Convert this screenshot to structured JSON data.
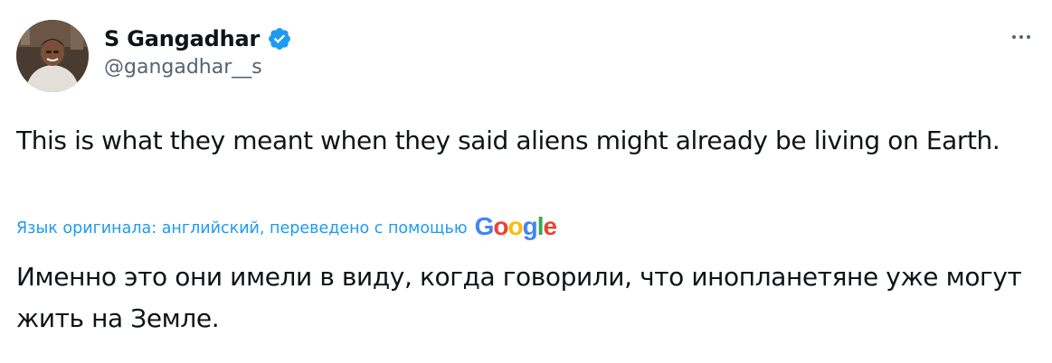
{
  "author": {
    "name": "S Gangadhar",
    "handle": "@gangadhar__s",
    "verified": true
  },
  "tweet": {
    "text": "This is what they meant when they said aliens might already be living on Earth.",
    "translation_label": "Язык оригинала: английский, переведено с помощью",
    "translation_provider": [
      "G",
      "o",
      "o",
      "g",
      "l",
      "e"
    ],
    "translated_text": "Именно это они имели в виду, когда говорили, что инопланетяне уже могут жить на Земле."
  },
  "icons": {
    "verified": "verified-badge-icon",
    "more": "more-options-icon"
  },
  "colors": {
    "accent": "#1d9bf0",
    "text": "#0f1419",
    "secondary": "#536471",
    "google_blue": "#4285F4",
    "google_red": "#EA4335",
    "google_yellow": "#FBBC05",
    "google_green": "#34A853"
  }
}
